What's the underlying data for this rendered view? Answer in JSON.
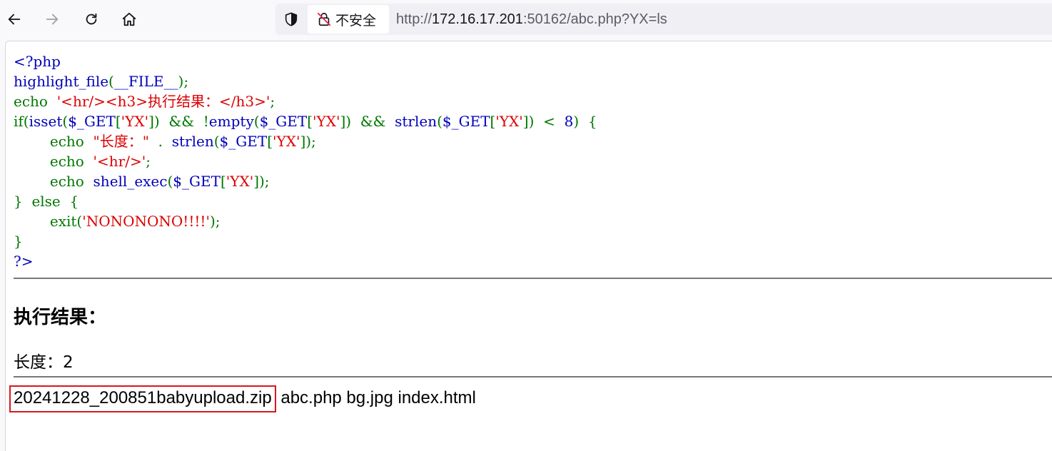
{
  "browser": {
    "security_label": "不安全",
    "url_prefix": "http://",
    "url_host": "172.16.17.201",
    "url_rest": ":50162/abc.php?YX=ls"
  },
  "code": {
    "line1": "<?php",
    "line2_fn": "highlight_file",
    "line2_open": "(",
    "line2_const": "__FILE__",
    "line2_close": ");",
    "line3_echo": "echo  ",
    "line3_str": "'<hr/><h3>执行结果：</h3>'",
    "line3_end": ";",
    "line4_a": "if(",
    "line4_isset": "isset",
    "line4_b": "(",
    "line4_get1": "$_GET",
    "line4_c": "[",
    "line4_yx1": "'YX'",
    "line4_d": "])  &&  !",
    "line4_empty": "empty",
    "line4_e": "(",
    "line4_get2": "$_GET",
    "line4_f": "[",
    "line4_yx2": "'YX'",
    "line4_g": "])  &&  ",
    "line4_strlen": "strlen",
    "line4_h": "(",
    "line4_get3": "$_GET",
    "line4_i": "[",
    "line4_yx3": "'YX'",
    "line4_j": "])  <  ",
    "line4_eight": "8",
    "line4_k": ")  {",
    "line5_echo": "        echo  ",
    "line5_str": "\"长度：\"",
    "line5_dot": "  .  ",
    "line5_strlen": "strlen",
    "line5_a": "(",
    "line5_get": "$_GET",
    "line5_b": "[",
    "line5_yx": "'YX'",
    "line5_c": "]);",
    "line6_echo": "        echo  ",
    "line6_str": "'<hr/>'",
    "line6_end": ";",
    "line7_echo": "        echo  ",
    "line7_fn": "shell_exec",
    "line7_a": "(",
    "line7_get": "$_GET",
    "line7_b": "[",
    "line7_yx": "'YX'",
    "line7_c": "]);",
    "line8": "}  else  {",
    "line9_exit": "        exit(",
    "line9_str": "'NONONONO!!!!'",
    "line9_end": ");",
    "line10": "}",
    "line11": "?>"
  },
  "result": {
    "heading": "执行结果：",
    "length_line": "长度：2",
    "highlighted_file": "20241228_200851babyupload.zip",
    "other_files": " abc.php bg.jpg index.html"
  },
  "colors": {
    "php_default": "#0000bb",
    "php_keyword": "#007700",
    "php_string": "#dd0000",
    "highlight_box": "#d7191c"
  }
}
